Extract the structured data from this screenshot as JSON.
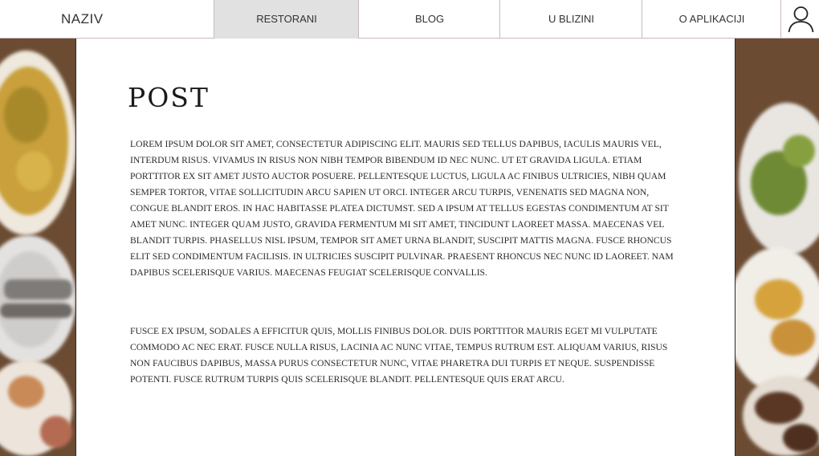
{
  "header": {
    "brand": "NAZIV",
    "nav": [
      {
        "label": "RESTORANI",
        "active": true
      },
      {
        "label": "BLOG",
        "active": false
      },
      {
        "label": "U BLIZINI",
        "active": false
      },
      {
        "label": "O APLIKACIJI",
        "active": false
      }
    ],
    "user_icon": "user-icon"
  },
  "post": {
    "title": "POST",
    "paragraphs": [
      "LOREM IPSUM DOLOR SIT AMET, CONSECTETUR ADIPISCING ELIT. MAURIS SED TELLUS DAPIBUS, IACULIS MAURIS VEL, INTERDUM RISUS. VIVAMUS IN RISUS NON NIBH TEMPOR BIBENDUM ID NEC NUNC. UT ET GRAVIDA LIGULA. ETIAM PORTTITOR EX SIT AMET JUSTO AUCTOR POSUERE. PELLENTESQUE LUCTUS, LIGULA AC FINIBUS ULTRICIES, NIBH QUAM SEMPER TORTOR, VITAE SOLLICITUDIN ARCU SAPIEN UT ORCI. INTEGER ARCU TURPIS, VENENATIS SED MAGNA NON, CONGUE BLANDIT EROS. IN HAC HABITASSE PLATEA DICTUMST. SED A IPSUM AT TELLUS EGESTAS CONDIMENTUM AT SIT AMET NUNC. INTEGER QUAM JUSTO, GRAVIDA FERMENTUM MI SIT AMET, TINCIDUNT LAOREET MASSA. MAECENAS VEL BLANDIT TURPIS. PHASELLUS NISL IPSUM, TEMPOR SIT AMET URNA BLANDIT, SUSCIPIT MATTIS MAGNA. FUSCE RHONCUS ELIT SED CONDIMENTUM FACILISIS. IN ULTRICIES SUSCIPIT PULVINAR. PRAESENT RHONCUS NEC NUNC ID LAOREET. NAM DAPIBUS SCELERISQUE VARIUS. MAECENAS FEUGIAT SCELERISQUE CONVALLIS.",
      "FUSCE EX IPSUM, SODALES A EFFICITUR QUIS, MOLLIS FINIBUS DOLOR. DUIS PORTTITOR MAURIS EGET MI VULPUTATE COMMODO AC NEC ERAT. FUSCE NULLA RISUS, LACINIA AC NUNC VITAE, TEMPUS RUTRUM EST. ALIQUAM VARIUS, RISUS NON FAUCIBUS DAPIBUS, MASSA PURUS CONSECTETUR NUNC, VITAE PHARETRA DUI TURPIS ET NEQUE. SUSPENDISSE POTENTI. FUSCE RUTRUM TURPIS QUIS SCELERISQUE BLANDIT. PELLENTESQUE QUIS ERAT ARCU."
    ]
  },
  "colors": {
    "active_tab": "#e1e1e1",
    "divider": "#c9b8bd",
    "panel_border": "#2a2a2a"
  }
}
